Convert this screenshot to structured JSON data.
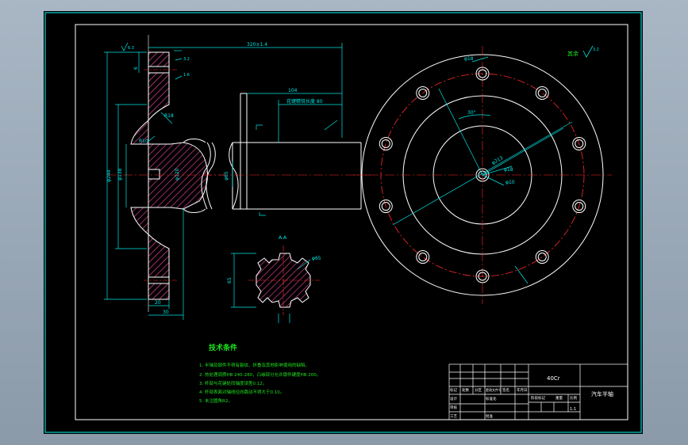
{
  "colors": {
    "background": "#000000",
    "outline": "#ffffff",
    "dimension": "#00e5e5",
    "centerline": "#ff2a2a",
    "hatch": "#ff4da6",
    "notes": "#1fe51f",
    "frame_border": "#00d0d0",
    "title_text": "#ffffff"
  },
  "dims": {
    "total_length": "320±1.4",
    "flange_dia": "φ244",
    "step_dia_1": "φ138",
    "step_dia_2": "φ120",
    "shaft_dia": "φ65",
    "spline_len_label": "花键精铣长度 80",
    "length_104": "104",
    "flange_thk": "20",
    "hub_len": "30",
    "radius_r18": "R18",
    "radius_r10": "R10",
    "hole_6": "6",
    "spline_od": "φ65",
    "spline_width": "65",
    "bolt_circle": "φ213",
    "bolt_hole": "φ18",
    "center_hole": "φ10",
    "angle": "30°",
    "bolt_hole_2": "φ18",
    "surface_mark": "其余",
    "roughness_top": "6.3",
    "roughness_a": "3.2",
    "roughness_b": "1.6"
  },
  "section_label": "A-A",
  "notes": {
    "title": "技术条件",
    "items": [
      "1. 半轴及锻件不得有裂纹、折叠及其他影响使用的缺陷。",
      "2. 热处理调质HB 240-280，凸缘部分允许锻件硬度HB 200。",
      "3. 杆部与花键处同轴度误差0.12。",
      "4. 杆部表面对轴线径向跳动不得大于0.10。",
      "5. 未注圆角R2。"
    ]
  },
  "title_block": {
    "code": "40Cr",
    "name": "汽车半轴",
    "scale": "1:1",
    "label_stage": "阶段标记",
    "label_weight": "重量",
    "label_scale": "比例",
    "label_design": "设计",
    "label_check": "审核",
    "label_process": "工艺",
    "label_approve": "批准",
    "label_mark": "标记",
    "label_count": "处数",
    "label_zone": "分区",
    "label_doc": "更改文件号",
    "label_sign": "签名",
    "label_date": "年月日",
    "label_std": "标准化"
  }
}
